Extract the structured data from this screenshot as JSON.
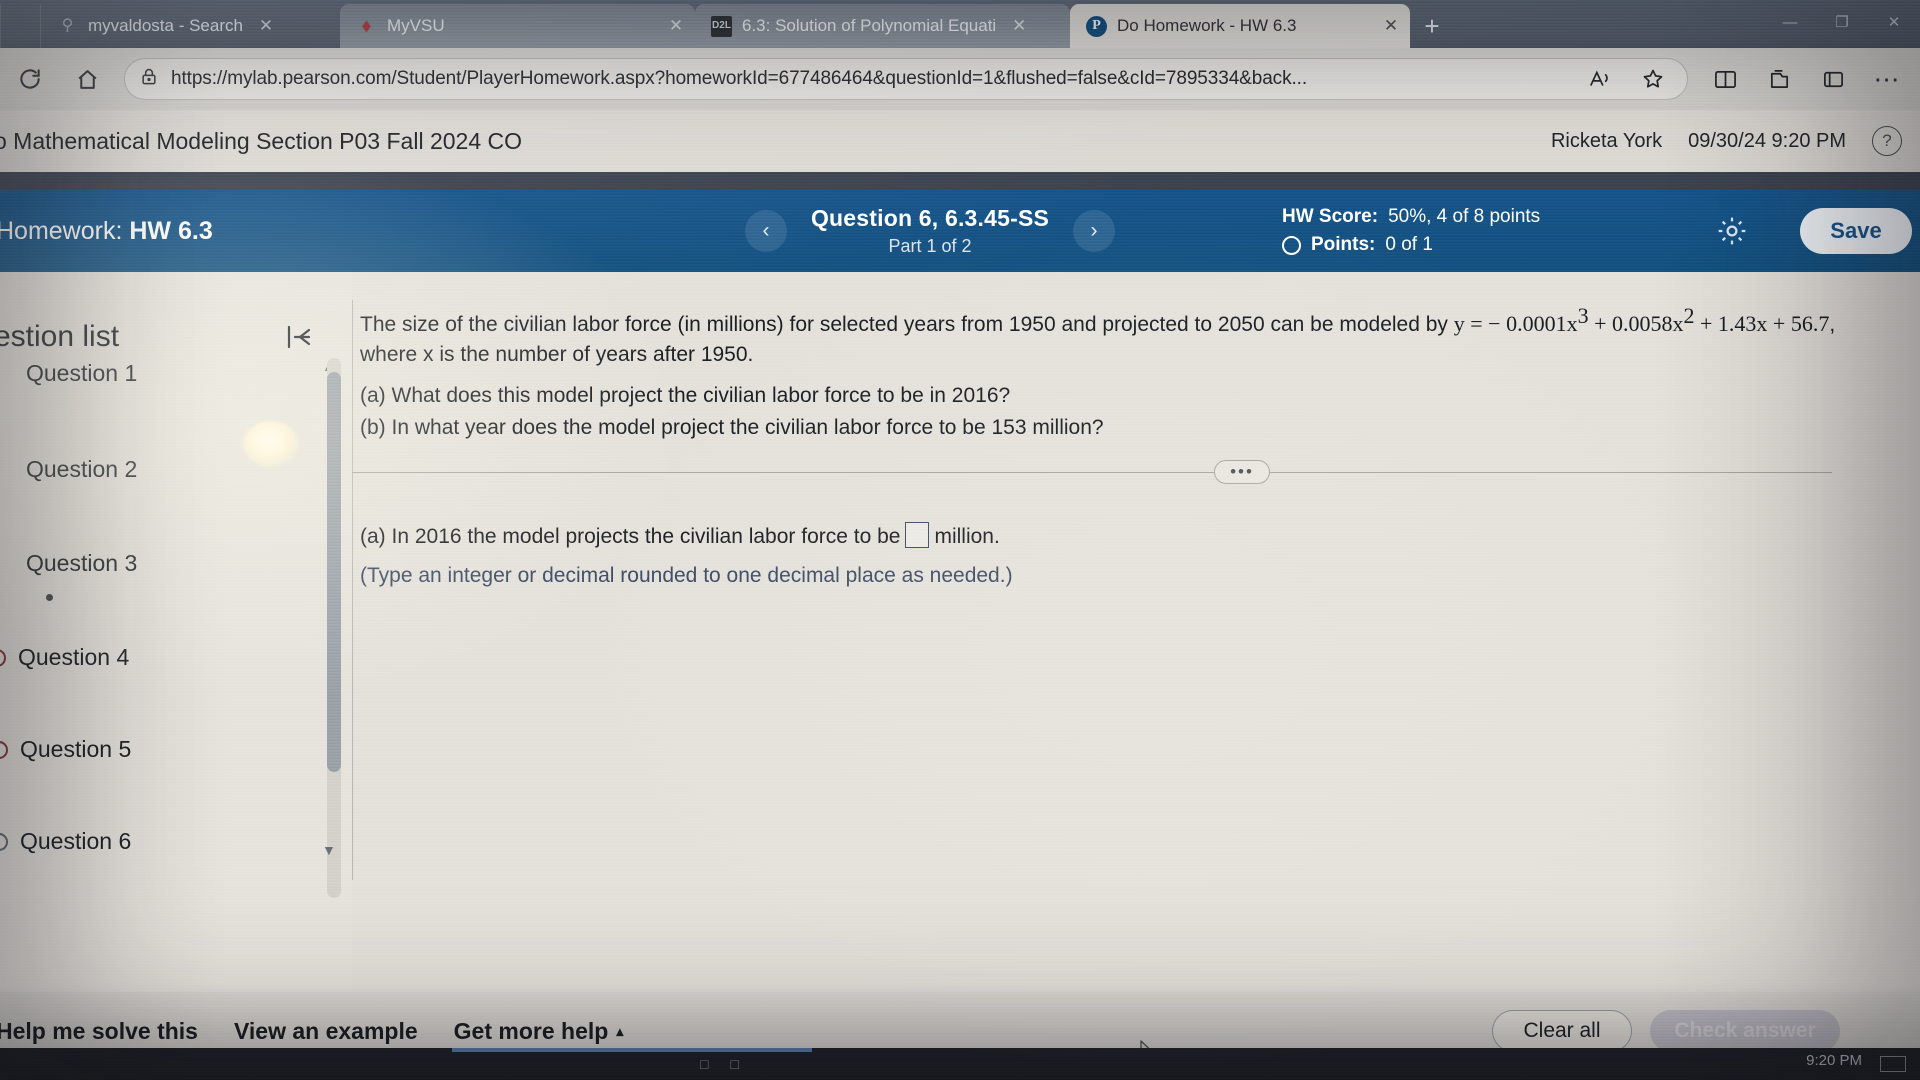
{
  "browser": {
    "tabs": [
      {
        "title": "myvaldosta - Search",
        "favicon": "search-icon",
        "state": "inactive"
      },
      {
        "title": "MyVSU",
        "favicon": "vsu-logo-icon",
        "state": "inactive"
      },
      {
        "title": "6.3: Solution of Polynomial Equati",
        "favicon": "d2l-icon",
        "state": "current"
      },
      {
        "title": "Do Homework - HW 6.3",
        "favicon": "pearson-icon",
        "state": "active-page"
      }
    ],
    "tab_close_label": "✕",
    "new_tab_label": "+",
    "window_controls": {
      "minimize": "—",
      "maximize": "❐",
      "close": "✕"
    },
    "nav": {
      "refresh_icon": "refresh-icon",
      "home_icon": "home-icon",
      "lock_icon": "lock-icon",
      "url": "https://mylab.pearson.com/Student/PlayerHomework.aspx?homeworkId=677486464&questionId=1&flushed=false&cId=7895334&back...",
      "read_aloud_icon": "read-aloud-icon",
      "favorite_icon": "star-icon",
      "split_screen_icon": "split-screen-icon",
      "collections_icon": "collections-icon",
      "browser_essentials_icon": "browser-essentials-icon",
      "settings_icon": "more-options-icon"
    }
  },
  "app_header": {
    "course_title": "o Mathematical Modeling Section P03 Fall 2024 CO",
    "user_name": "Ricketa York",
    "timestamp": "09/30/24 9:20 PM",
    "help_label": "?"
  },
  "hw_bar": {
    "homework_label": "Homework:",
    "homework_name": "HW 6.3",
    "prev_label": "‹",
    "next_label": "›",
    "question_title": "Question 6, 6.3.45-SS",
    "part_label": "Part 1 of 2",
    "hw_score_label": "HW Score:",
    "hw_score_value": "50%, 4 of 8 points",
    "points_label": "Points:",
    "points_value": "0 of 1",
    "settings_icon": "gear-icon",
    "save_label": "Save",
    "accent_color": "#17548a"
  },
  "sidebar": {
    "heading": "estion list",
    "collapse_icon": "collapse-panel-icon",
    "items": [
      {
        "label": "Question 1",
        "mark": "blank"
      },
      {
        "label": "Question 2",
        "mark": "blank"
      },
      {
        "label": "Question 3",
        "mark": "dot"
      },
      {
        "label": "Question 4",
        "mark": "incorrect"
      },
      {
        "label": "Question 5",
        "mark": "incorrect"
      },
      {
        "label": "Question 6",
        "mark": "open"
      }
    ]
  },
  "problem": {
    "stem_part1": "The size of the civilian labor force (in millions) for selected years from 1950 and projected to 2050 can be modeled by ",
    "equation": "y = − 0.0001x",
    "exp1": "3",
    "equation2": " + 0.0058x",
    "exp2": "2",
    "equation3": " + 1.43x + 56.7",
    "stem_part2": ", where x is the number of years after 1950.",
    "part_a": "(a) What does this model project the civilian labor force to be in 2016?",
    "part_b": "(b) In what year does the model project the civilian labor force to be 153 million?",
    "more_dots": "•••"
  },
  "answer": {
    "prompt_prefix": "(a) In 2016 the model projects the civilian labor force to be",
    "input_value": "",
    "prompt_suffix": "million.",
    "hint": "(Type an integer or decimal rounded to one decimal place as needed.)"
  },
  "bottom": {
    "help_me_solve": "Help me solve this",
    "view_example": "View an example",
    "get_more_help": "Get more help",
    "get_more_help_caret": "▴",
    "clear_all": "Clear all",
    "check_answer": "Check answer"
  },
  "taskbar": {
    "clock": "9:20 PM"
  }
}
